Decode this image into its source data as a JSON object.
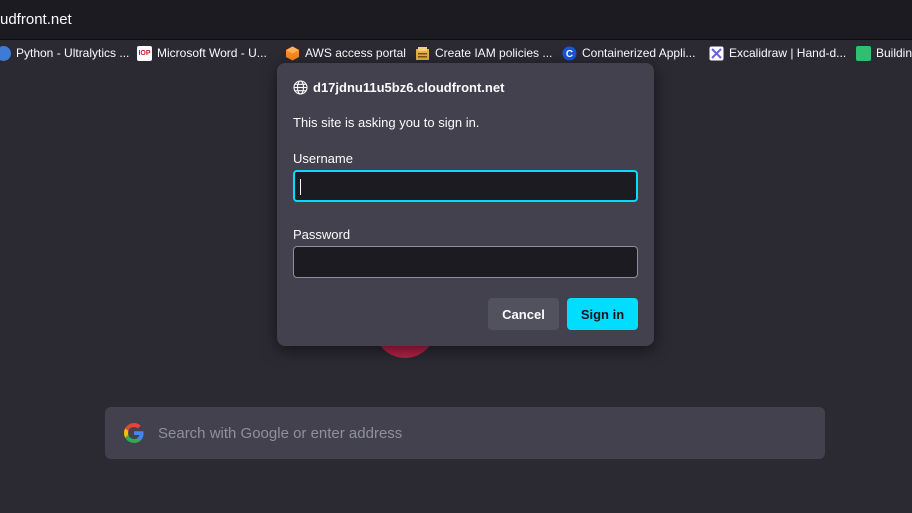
{
  "url_bar": {
    "text": "udfront.net"
  },
  "bookmarks": [
    {
      "label": "Python - Ultralytics ...",
      "icon": "python-icon"
    },
    {
      "label": "Microsoft Word - U...",
      "icon": "iop-icon"
    },
    {
      "label": "AWS access portal",
      "icon": "aws-icon"
    },
    {
      "label": "Create IAM policies ...",
      "icon": "aws-docs-icon"
    },
    {
      "label": "Containerized Appli...",
      "icon": "containerized-icon"
    },
    {
      "label": "Excalidraw | Hand-d...",
      "icon": "excalidraw-icon"
    },
    {
      "label": "Buildin",
      "icon": "building-icon"
    }
  ],
  "dialog": {
    "host": "d17jdnu11u5bz6.cloudfront.net",
    "message": "This site is asking you to sign in.",
    "username_label": "Username",
    "username_value": "",
    "password_label": "Password",
    "password_value": "",
    "cancel_label": "Cancel",
    "signin_label": "Sign in"
  },
  "search": {
    "placeholder": "Search with Google or enter address"
  },
  "colors": {
    "accent": "#00ddff",
    "dialog_bg": "#42414d",
    "page_bg": "#2b2a33"
  }
}
